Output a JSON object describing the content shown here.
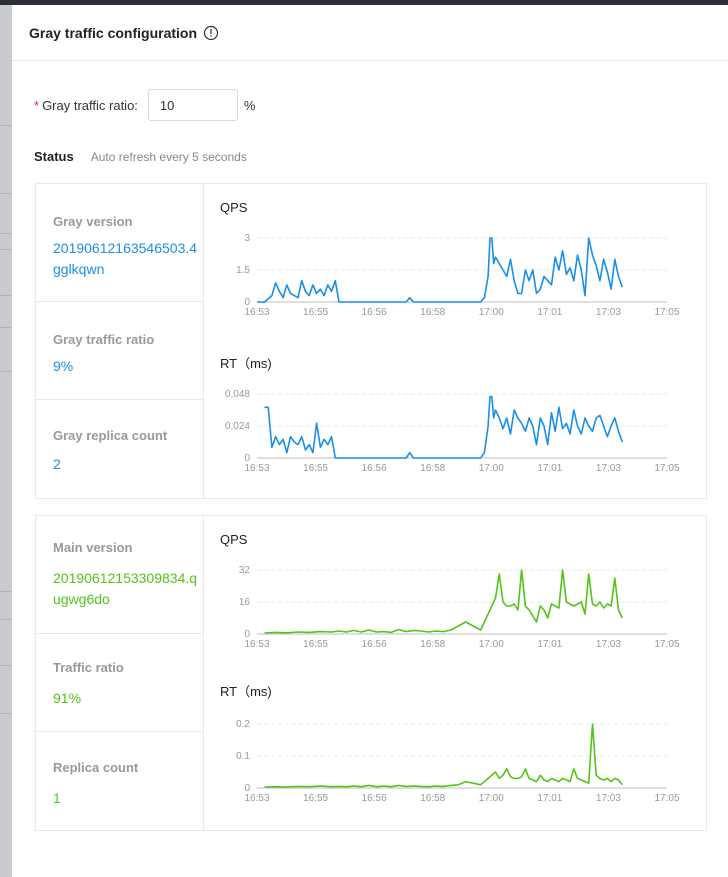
{
  "dialog": {
    "title": "Gray traffic configuration",
    "info_icon": "info-circle-icon"
  },
  "form": {
    "ratio_label": "Gray traffic ratio:",
    "ratio_value": "10",
    "ratio_unit": "%"
  },
  "status": {
    "title": "Status",
    "subtitle": "Auto refresh every 5 seconds"
  },
  "gray": {
    "version_label": "Gray version",
    "version_value": "20190612163546503.4gglkqwn",
    "ratio_label": "Gray traffic ratio",
    "ratio_value": "9%",
    "replica_label": "Gray replica count",
    "replica_value": "2",
    "color": "#1a8fe8"
  },
  "main": {
    "version_label": "Main version",
    "version_value": "20190612153309834.qugwg6do",
    "ratio_label": "Traffic ratio",
    "ratio_value": "91%",
    "replica_label": "Replica count",
    "replica_value": "1",
    "color": "#52c41a"
  },
  "chart_titles": {
    "qps": "QPS",
    "rt": "RT（ms)"
  },
  "chart_data": [
    {
      "type": "line",
      "title": "QPS",
      "group": "gray",
      "x_ticks": [
        "16:53",
        "16:55",
        "16:56",
        "16:58",
        "17:00",
        "17:01",
        "17:03",
        "17:05"
      ],
      "y_ticks": [
        "0",
        "1.5",
        "3"
      ],
      "ylim": [
        0,
        3
      ],
      "x": [
        0,
        2,
        4,
        5,
        6,
        7,
        8,
        9,
        10,
        11,
        12,
        13,
        14,
        15,
        16,
        17,
        18,
        19,
        20,
        21,
        22,
        23,
        24,
        25,
        26,
        27,
        28,
        29,
        30,
        40,
        41,
        42,
        60,
        61,
        62,
        62.5,
        63,
        63.5,
        64,
        65,
        66,
        67,
        68,
        69,
        70,
        71,
        72,
        73,
        74,
        75,
        76,
        77,
        78,
        79,
        80,
        81,
        82,
        83,
        84,
        85,
        86,
        87,
        88,
        89,
        90,
        91,
        92,
        93,
        94,
        95,
        96,
        97,
        98
      ],
      "values": [
        0,
        0,
        0.3,
        0.9,
        0.5,
        0.2,
        0.8,
        0.4,
        0.3,
        0.2,
        1.0,
        0.5,
        0.3,
        0.8,
        0.4,
        0.6,
        0.3,
        0.8,
        0.5,
        1.0,
        0,
        0,
        0,
        0,
        0,
        0,
        0,
        0,
        0,
        0,
        0.2,
        0,
        0,
        0.2,
        1.2,
        3.0,
        3.0,
        1.8,
        2.1,
        1.8,
        1.5,
        1.2,
        2.0,
        1.0,
        0.4,
        0.4,
        1.5,
        1.0,
        1.5,
        0.4,
        0.6,
        1.2,
        1.0,
        0.8,
        2.1,
        1.5,
        2.4,
        1.3,
        1.6,
        1.0,
        2.2,
        1.5,
        0.3,
        3.0,
        2.2,
        1.7,
        1.0,
        2.0,
        1.4,
        0.6,
        2.0,
        1.2,
        0.7
      ],
      "xlim": [
        0,
        110
      ]
    },
    {
      "type": "line",
      "title": "RT（ms)",
      "group": "gray",
      "x_ticks": [
        "16:53",
        "16:55",
        "16:56",
        "16:58",
        "17:00",
        "17:01",
        "17:03",
        "17:05"
      ],
      "y_ticks": [
        "0",
        "0.024",
        "0.048"
      ],
      "ylim": [
        0,
        0.048
      ],
      "x": [
        2,
        3,
        4,
        5,
        6,
        7,
        8,
        9,
        10,
        11,
        12,
        13,
        14,
        15,
        16,
        17,
        18,
        19,
        20,
        21,
        22,
        23,
        24,
        25,
        26,
        40,
        41,
        42,
        60,
        61,
        62,
        62.5,
        63,
        63.5,
        64,
        65,
        66,
        67,
        68,
        69,
        70,
        71,
        72,
        73,
        74,
        75,
        76,
        77,
        78,
        79,
        80,
        81,
        82,
        83,
        84,
        85,
        86,
        87,
        88,
        89,
        90,
        91,
        92,
        93,
        94,
        95,
        96,
        97,
        98
      ],
      "values": [
        0.038,
        0.038,
        0.008,
        0.016,
        0.01,
        0.014,
        0.004,
        0.016,
        0.012,
        0.01,
        0.016,
        0.006,
        0.01,
        0.004,
        0.026,
        0.008,
        0.014,
        0.01,
        0.016,
        0,
        0,
        0,
        0,
        0,
        0,
        0,
        0.004,
        0,
        0,
        0.004,
        0.024,
        0.046,
        0.046,
        0.03,
        0.036,
        0.03,
        0.022,
        0.03,
        0.018,
        0.036,
        0.03,
        0.026,
        0.02,
        0.03,
        0.024,
        0.01,
        0.03,
        0.024,
        0.01,
        0.034,
        0.02,
        0.038,
        0.022,
        0.026,
        0.018,
        0.036,
        0.024,
        0.018,
        0.03,
        0.024,
        0.02,
        0.03,
        0.032,
        0.024,
        0.016,
        0.024,
        0.03,
        0.02,
        0.012
      ],
      "xlim": [
        0,
        110
      ]
    },
    {
      "type": "line",
      "title": "QPS",
      "group": "main",
      "x_ticks": [
        "16:53",
        "16:55",
        "16:56",
        "16:58",
        "17:00",
        "17:01",
        "17:03",
        "17:05"
      ],
      "y_ticks": [
        "0",
        "16",
        "32"
      ],
      "ylim": [
        0,
        32
      ],
      "x": [
        2,
        5,
        8,
        11,
        14,
        17,
        20,
        22,
        24,
        26,
        28,
        30,
        32,
        34,
        36,
        38,
        40,
        42,
        44,
        46,
        48,
        50,
        52,
        54,
        56,
        58,
        60,
        62,
        63,
        64,
        65,
        66,
        67,
        68,
        69,
        70,
        71,
        72,
        73,
        74,
        75,
        76,
        77,
        78,
        79,
        80,
        81,
        82,
        83,
        84,
        85,
        86,
        87,
        88,
        89,
        90,
        91,
        92,
        93,
        94,
        95,
        96,
        97,
        98
      ],
      "values": [
        0.5,
        0.8,
        0.6,
        1.0,
        0.8,
        1.2,
        1.0,
        1.5,
        1.0,
        1.8,
        1.0,
        2.0,
        1.0,
        1.2,
        0.8,
        2.2,
        1.2,
        1.8,
        1.5,
        1.0,
        1.5,
        1.2,
        2.0,
        4.0,
        6.0,
        4.0,
        2.0,
        10.0,
        14.0,
        18.0,
        30.0,
        16.0,
        14.0,
        14.0,
        15.0,
        12.0,
        32.0,
        14.0,
        12.0,
        9.0,
        6.0,
        14.0,
        12.0,
        8.0,
        15.0,
        14.0,
        13.0,
        32.0,
        16.0,
        15.0,
        14.0,
        15.0,
        16.0,
        10.0,
        30.0,
        15.0,
        14.0,
        16.0,
        13.0,
        15.0,
        14.0,
        28.0,
        12.0,
        8.0
      ],
      "xlim": [
        0,
        110
      ]
    },
    {
      "type": "line",
      "title": "RT（ms)",
      "group": "main",
      "x_ticks": [
        "16:53",
        "16:55",
        "16:56",
        "16:58",
        "17:00",
        "17:01",
        "17:03",
        "17:05"
      ],
      "y_ticks": [
        "0",
        "0.1",
        "0.2"
      ],
      "ylim": [
        0,
        0.2
      ],
      "x": [
        2,
        5,
        8,
        11,
        14,
        17,
        20,
        22,
        24,
        26,
        28,
        30,
        32,
        34,
        36,
        38,
        40,
        42,
        44,
        46,
        48,
        50,
        52,
        54,
        56,
        58,
        60,
        62,
        63,
        64,
        65,
        66,
        67,
        68,
        69,
        70,
        71,
        72,
        73,
        74,
        75,
        76,
        77,
        78,
        79,
        80,
        81,
        82,
        83,
        84,
        85,
        86,
        87,
        88,
        89,
        90,
        91,
        92,
        93,
        94,
        95,
        96,
        97,
        98
      ],
      "values": [
        0.003,
        0.004,
        0.003,
        0.005,
        0.004,
        0.006,
        0.004,
        0.005,
        0.004,
        0.006,
        0.004,
        0.008,
        0.004,
        0.006,
        0.004,
        0.008,
        0.005,
        0.006,
        0.005,
        0.004,
        0.006,
        0.005,
        0.008,
        0.01,
        0.02,
        0.015,
        0.01,
        0.03,
        0.04,
        0.05,
        0.03,
        0.04,
        0.06,
        0.035,
        0.03,
        0.03,
        0.035,
        0.06,
        0.03,
        0.025,
        0.02,
        0.04,
        0.025,
        0.02,
        0.03,
        0.025,
        0.02,
        0.03,
        0.025,
        0.02,
        0.06,
        0.03,
        0.025,
        0.02,
        0.015,
        0.2,
        0.04,
        0.03,
        0.025,
        0.03,
        0.02,
        0.03,
        0.025,
        0.01
      ],
      "xlim": [
        0,
        110
      ]
    }
  ]
}
